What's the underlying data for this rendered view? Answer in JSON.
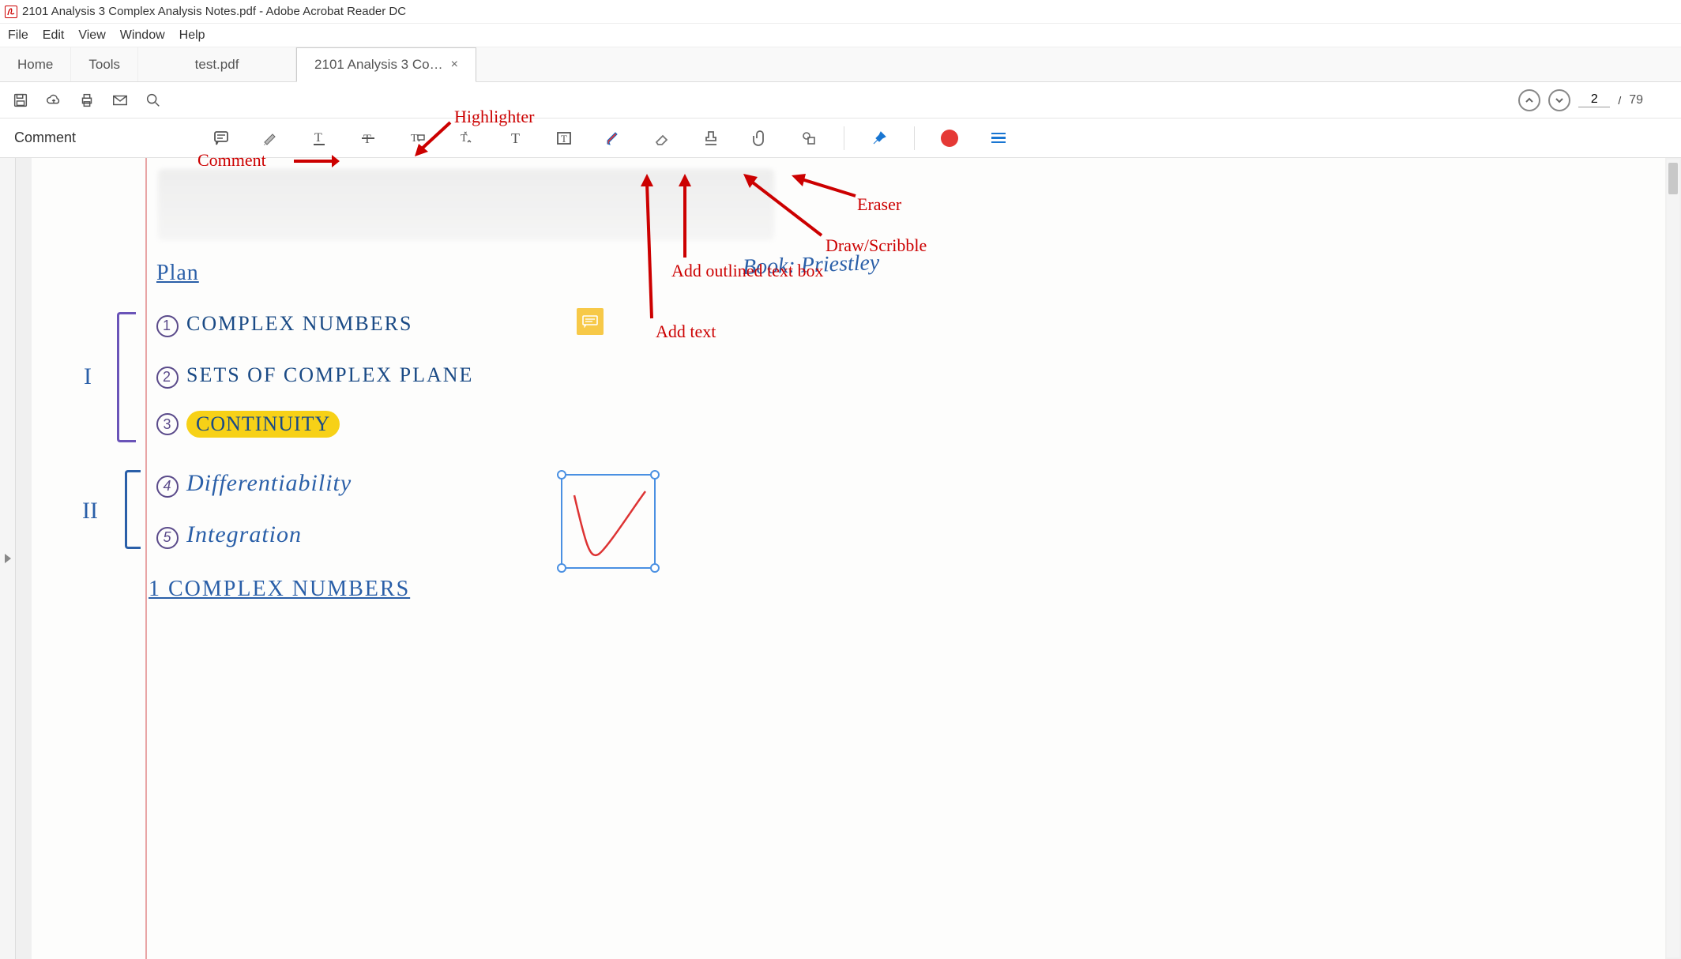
{
  "titlebar": {
    "title": "2101 Analysis 3 Complex Analysis Notes.pdf - Adobe Acrobat Reader DC"
  },
  "menubar": {
    "items": [
      "File",
      "Edit",
      "View",
      "Window",
      "Help"
    ]
  },
  "tabs": {
    "home": "Home",
    "tools": "Tools",
    "file1": "test.pdf",
    "file2": "2101 Analysis 3 Co…",
    "close": "×"
  },
  "pagenav": {
    "current": "2",
    "sep": "/",
    "total": "79"
  },
  "commentbar": {
    "label": "Comment"
  },
  "document": {
    "plan": "Plan",
    "line1": "COMPLEX  NUMBERS",
    "line2": "SETS  OF  COMPLEX  PLANE",
    "line3": "CONTINUITY",
    "line4": "Differentiability",
    "line5": "Integration",
    "section": "1 COMPLEX  NUMBERS",
    "roman1": "I",
    "roman2": "II",
    "n1": "1",
    "n2": "2",
    "n3": "3",
    "n4": "4",
    "n5": "5",
    "book": "Book: Priestley"
  },
  "annotations": {
    "comment": "Comment",
    "highlighter": "Highlighter",
    "addtext": "Add text",
    "addtextbox": "Add outlined text box",
    "draw": "Draw/Scribble",
    "eraser": "Eraser"
  }
}
